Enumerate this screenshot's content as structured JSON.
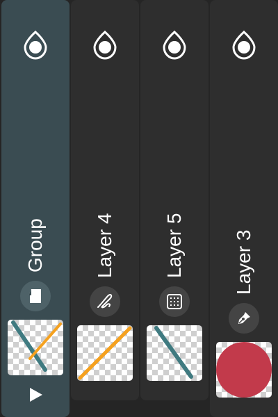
{
  "colors": {
    "panel": "#2e2e2e",
    "group_panel": "#3a4c52",
    "teal_stroke": "#3f7a80",
    "orange_stroke": "#f5a11f",
    "red_fill": "#c23a4b"
  },
  "layers": [
    {
      "label": "Group",
      "type_icon": "folder-icon",
      "visibility_icon": "eye-icon",
      "thumbnail": "teal-and-orange-lines",
      "selected": true
    },
    {
      "label": "Layer 4",
      "type_icon": "brush-icon",
      "visibility_icon": "eye-icon",
      "thumbnail": "orange-line"
    },
    {
      "label": "Layer 5",
      "type_icon": "pattern-icon",
      "visibility_icon": "eye-icon",
      "thumbnail": "teal-line"
    },
    {
      "label": "Layer 3",
      "type_icon": "pen-icon",
      "visibility_icon": "eye-icon",
      "thumbnail": "red-circle"
    }
  ],
  "group_expand_icon": "play-icon"
}
